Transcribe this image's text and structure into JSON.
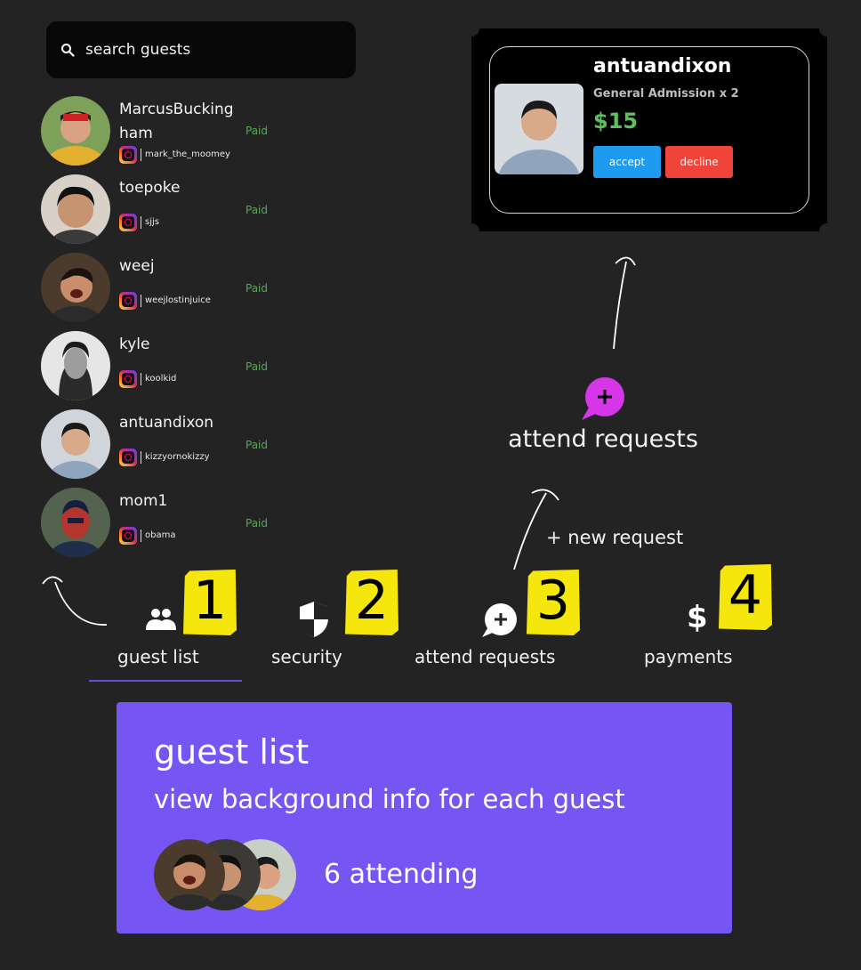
{
  "search": {
    "placeholder": "search guests",
    "icon": "search-icon"
  },
  "guests": [
    {
      "name": "MarcusBuckingham",
      "status": "Paid",
      "handle": "mark_the_moomey"
    },
    {
      "name": "toepoke",
      "status": "Paid",
      "handle": "sjjs"
    },
    {
      "name": "weej",
      "status": "Paid",
      "handle": "weejlostinjuice"
    },
    {
      "name": "kyle",
      "status": "Paid",
      "handle": "koolkid"
    },
    {
      "name": "antuandixon",
      "status": "Paid",
      "handle": "kizzyornokizzy"
    },
    {
      "name": "mom1",
      "status": "Paid",
      "handle": "obama"
    }
  ],
  "ticket": {
    "name": "antuandixon",
    "tier": "General Admission x 2",
    "price": "$15",
    "accept_label": "accept",
    "decline_label": "decline"
  },
  "attend_requests_preview": {
    "label": "attend requests",
    "new_request": "+ new request"
  },
  "nav": [
    {
      "label": "guest list",
      "badge": "1",
      "icon": "people-icon"
    },
    {
      "label": "security",
      "badge": "2",
      "icon": "shield-icon"
    },
    {
      "label": "attend requests",
      "badge": "3",
      "icon": "chat-plus-icon"
    },
    {
      "label": "payments",
      "badge": "4",
      "icon": "dollar-icon"
    }
  ],
  "panel": {
    "title": "guest list",
    "subtitle": "view background info for each guest",
    "attending": "6 attending"
  },
  "colors": {
    "background": "#232323",
    "accent": "#7556f2",
    "paid": "#4caf50",
    "accept": "#1e9bf0",
    "decline": "#f0433a",
    "badge": "#f5e60e",
    "request_icon": "#d636e8"
  }
}
